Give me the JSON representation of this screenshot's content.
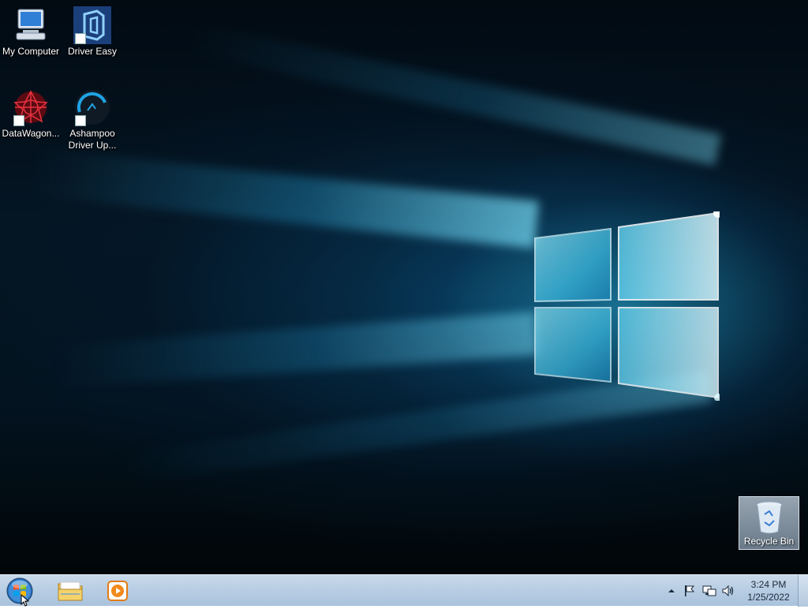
{
  "desktop": {
    "icons": [
      {
        "label": "My Computer",
        "icon": "computer-icon"
      },
      {
        "label": "Driver Easy",
        "icon": "driver-easy-icon"
      },
      {
        "label": "DataWagon...",
        "icon": "datawagon-icon"
      },
      {
        "label_line1": "Ashampoo",
        "label_line2": "Driver Up...",
        "icon": "ashampoo-driver-updater-icon"
      }
    ],
    "recycle_bin": {
      "label": "Recycle Bin",
      "icon": "recycle-bin-icon"
    }
  },
  "taskbar": {
    "start_button": {
      "icon": "windows-start-orb-icon"
    },
    "pinned": [
      {
        "icon": "file-explorer-icon"
      },
      {
        "icon": "media-player-icon"
      }
    ],
    "tray": {
      "icons": [
        "show-hidden-icons-icon",
        "action-center-flag-icon",
        "network-icon",
        "volume-icon"
      ]
    },
    "clock": {
      "time": "3:24 PM",
      "date": "1/25/2022"
    }
  },
  "colors": {
    "wallpaper_glow": "#28aad2",
    "taskbar_bg": "#b7cde3",
    "icon_text": "#ffffff"
  }
}
